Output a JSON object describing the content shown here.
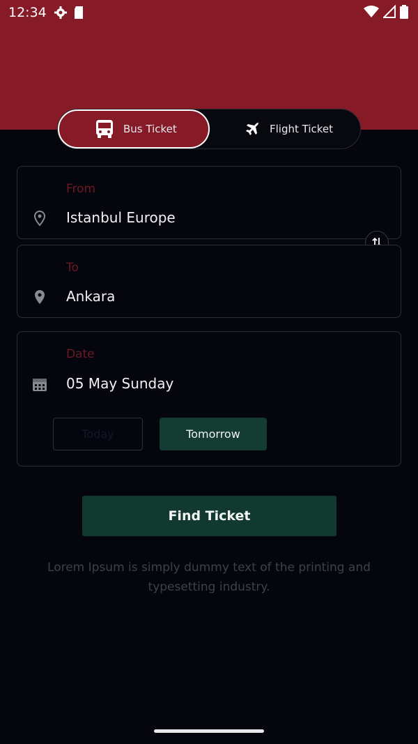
{
  "status_bar": {
    "time": "12:34"
  },
  "tabs": [
    {
      "label": "Bus Ticket",
      "icon": "bus-icon",
      "active": true
    },
    {
      "label": "Flight Ticket",
      "icon": "airplane-icon",
      "active": false
    }
  ],
  "from": {
    "label": "From",
    "value": "Istanbul Europe",
    "icon": "location-pin-outline-icon"
  },
  "to": {
    "label": "To",
    "value": "Ankara",
    "icon": "location-pin-filled-icon"
  },
  "date": {
    "label": "Date",
    "value": "05 May Sunday",
    "icon": "calendar-icon",
    "today_label": "Today",
    "tomorrow_label": "Tomorrow"
  },
  "find_button": {
    "label": "Find Ticket"
  },
  "description": "Lorem Ipsum is simply dummy text of the printing and typesetting industry.",
  "colors": {
    "primary": "#861a27",
    "accent_green": "#12392f",
    "background": "#05050d"
  }
}
